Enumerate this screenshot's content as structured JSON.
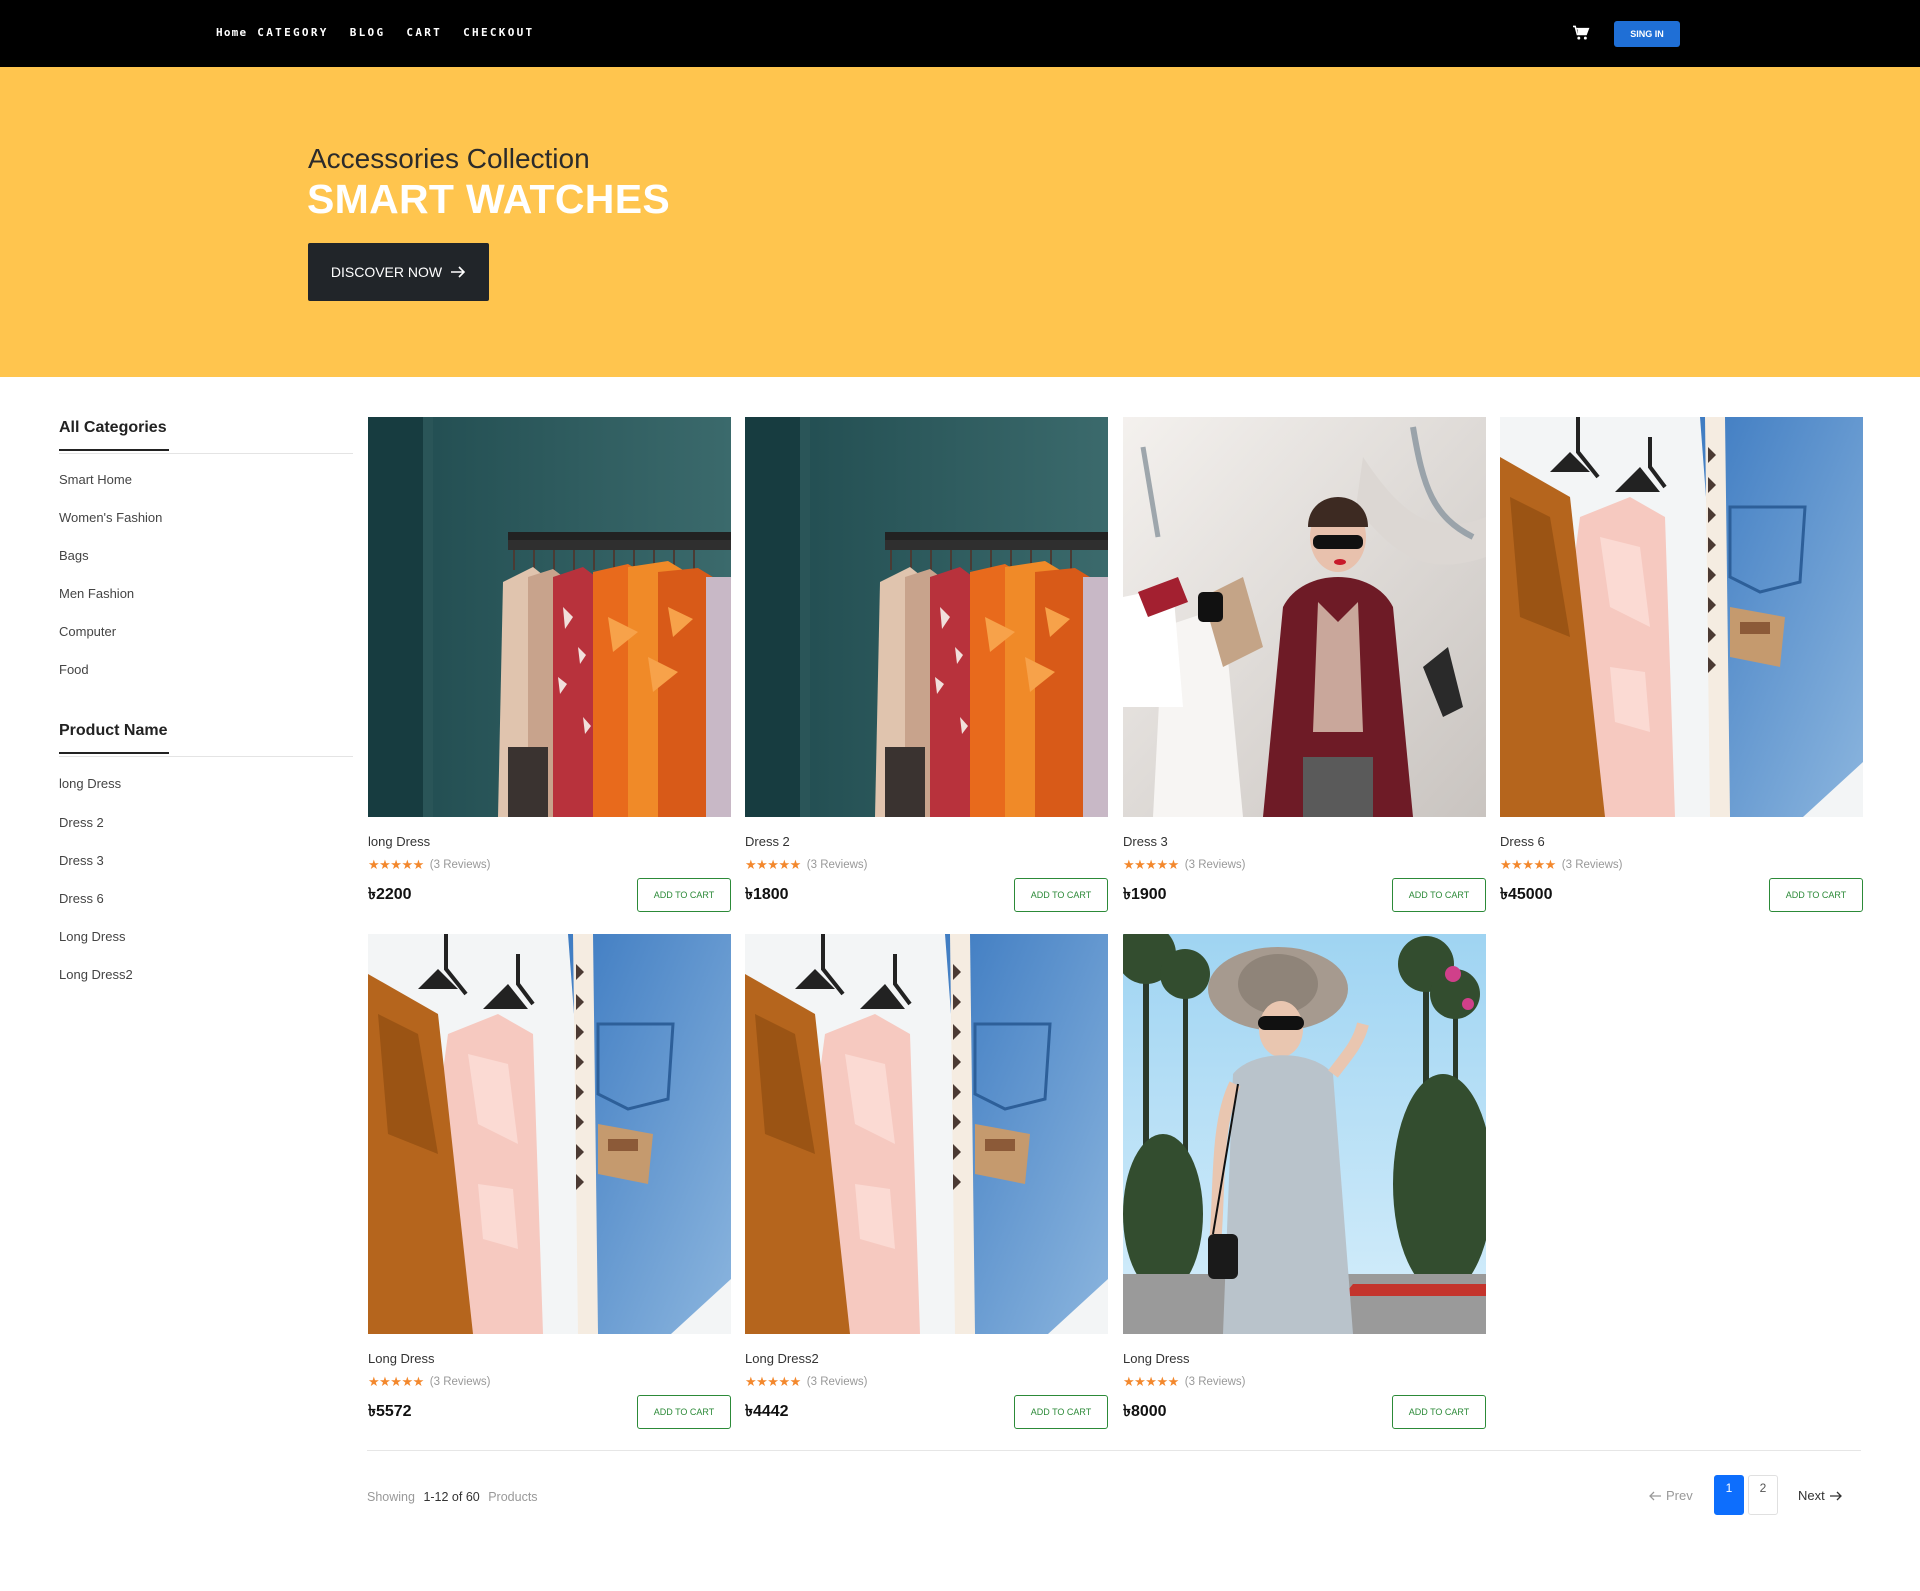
{
  "nav": {
    "links": [
      "Home",
      "CATEGORY",
      "BLOG",
      "CART",
      "CHECKOUT"
    ],
    "signin_label": "SING IN"
  },
  "hero": {
    "subtitle": "Accessories Collection",
    "title": "SMART WATCHES",
    "button_label": "DISCOVER NOW"
  },
  "sidebar": {
    "categories_heading": "All Categories",
    "categories": [
      "Smart Home",
      "Women's Fashion",
      "Bags",
      "Men Fashion",
      "Computer",
      "Food"
    ],
    "products_heading": "Product Name",
    "products": [
      "long Dress",
      "Dress 2",
      "Dress 3",
      "Dress 6",
      "Long Dress",
      "Long Dress2"
    ]
  },
  "products": [
    {
      "name": "long Dress",
      "price": "৳2200",
      "reviews": "(3 Reviews)",
      "rating": 5,
      "image": "clothing-rack"
    },
    {
      "name": "Dress 2",
      "price": "৳1800",
      "reviews": "(3 Reviews)",
      "rating": 5,
      "image": "clothing-rack"
    },
    {
      "name": "Dress 3",
      "price": "৳1900",
      "reviews": "(3 Reviews)",
      "rating": 5,
      "image": "woman-shopping-bags"
    },
    {
      "name": "Dress 6",
      "price": "৳45000",
      "reviews": "(3 Reviews)",
      "rating": 5,
      "image": "jacket-jeans-hangers"
    },
    {
      "name": "Long Dress",
      "price": "৳5572",
      "reviews": "(3 Reviews)",
      "rating": 5,
      "image": "jacket-jeans-hangers"
    },
    {
      "name": "Long Dress2",
      "price": "৳4442",
      "reviews": "(3 Reviews)",
      "rating": 5,
      "image": "jacket-jeans-hangers"
    },
    {
      "name": "Long Dress",
      "price": "৳8000",
      "reviews": "(3 Reviews)",
      "rating": 5,
      "image": "woman-hat-palms"
    }
  ],
  "add_to_cart_label": "ADD TO CART",
  "pagination": {
    "showing_label": "Showing",
    "range": "1-12 of 60",
    "products_label": "Products",
    "prev_label": "Prev",
    "next_label": "Next",
    "pages": [
      "1",
      "2"
    ],
    "current_page": "1"
  },
  "colors": {
    "hero_bg": "#ffc54e",
    "navbar_bg": "#000000",
    "signin_bg": "#1f6fd6",
    "star": "#f3882d",
    "add_to_cart_border": "#2c8a38",
    "active_page": "#0d6efd"
  }
}
